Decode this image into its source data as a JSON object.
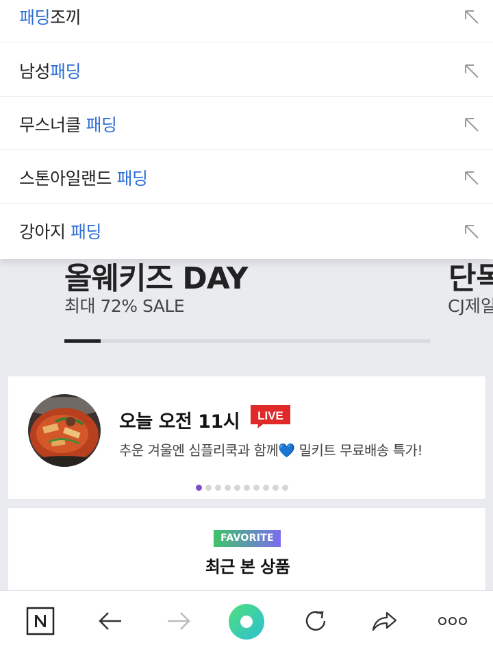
{
  "suggestions": [
    {
      "parts": [
        "패딩",
        "조끼"
      ],
      "hl": [
        true,
        false
      ]
    },
    {
      "parts": [
        "남성",
        "패딩"
      ],
      "hl": [
        false,
        true
      ]
    },
    {
      "parts": [
        "무스너클 ",
        "패딩"
      ],
      "hl": [
        false,
        true
      ]
    },
    {
      "parts": [
        "스톤아일랜드 ",
        "패딩"
      ],
      "hl": [
        false,
        true
      ]
    },
    {
      "parts": [
        "강아지 ",
        "패딩"
      ],
      "hl": [
        false,
        true
      ]
    }
  ],
  "banner": {
    "title": "올웨키즈 DAY",
    "subtitle": "최대 72% SALE",
    "next_title": "단독",
    "next_subtitle": "CJ제일",
    "progress": 0.1
  },
  "live": {
    "title": "오늘 오전 11시",
    "badge": "LIVE",
    "description": "추운 겨울엔 심플리쿡과 함께💙 밀키트 무료배송 특가!",
    "page_count": 10,
    "active_page": 0
  },
  "favorite": {
    "badge": "FAVORITE",
    "title": "최근 본 상품"
  },
  "bottom_bar": {
    "items": [
      "naver-home",
      "back",
      "forward",
      "green-dot",
      "refresh",
      "share",
      "more"
    ]
  },
  "colors": {
    "highlight": "#2f6fd6",
    "live_red": "#e02a2a",
    "green_dot": "#3ed39a",
    "active_dot": "#7b4fc8"
  }
}
